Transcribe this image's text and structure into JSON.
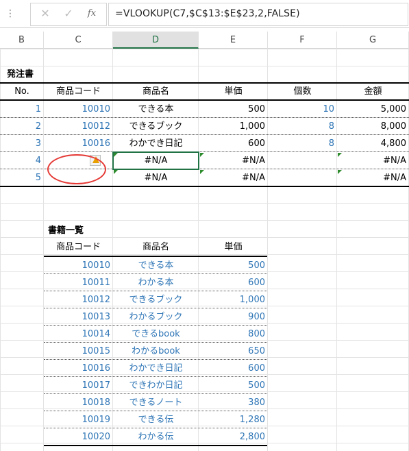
{
  "formula_bar": {
    "cancel_icon": "✕",
    "enter_icon": "✓",
    "fx_label": "fx",
    "formula": "=VLOOKUP(C7,$C$13:$E$23,2,FALSE)"
  },
  "columns": [
    "B",
    "C",
    "D",
    "E",
    "F",
    "G"
  ],
  "order": {
    "title": "発注書",
    "headers": {
      "no": "No.",
      "code": "商品コード",
      "name": "商品名",
      "price": "単価",
      "qty": "個数",
      "amount": "金額"
    },
    "rows": [
      {
        "no": "1",
        "code": "10010",
        "name": "できる本",
        "price": "500",
        "qty": "10",
        "amount": "5,000"
      },
      {
        "no": "2",
        "code": "10012",
        "name": "できるブック",
        "price": "1,000",
        "qty": "8",
        "amount": "8,000"
      },
      {
        "no": "3",
        "code": "10016",
        "name": "わかでき日記",
        "price": "600",
        "qty": "8",
        "amount": "4,800"
      },
      {
        "no": "4",
        "code": "",
        "name": "#N/A",
        "price": "#N/A",
        "qty": "",
        "amount": "#N/A"
      },
      {
        "no": "5",
        "code": "",
        "name": "#N/A",
        "price": "#N/A",
        "qty": "",
        "amount": "#N/A"
      }
    ]
  },
  "books": {
    "title": "書籍一覧",
    "headers": {
      "code": "商品コード",
      "name": "商品名",
      "price": "単価"
    },
    "rows": [
      {
        "code": "10010",
        "name": "できる本",
        "price": "500"
      },
      {
        "code": "10011",
        "name": "わかる本",
        "price": "600"
      },
      {
        "code": "10012",
        "name": "できるブック",
        "price": "1,000"
      },
      {
        "code": "10013",
        "name": "わかるブック",
        "price": "900"
      },
      {
        "code": "10014",
        "name": "できるbook",
        "price": "800"
      },
      {
        "code": "10015",
        "name": "わかるbook",
        "price": "650"
      },
      {
        "code": "10016",
        "name": "わかでき日記",
        "price": "600"
      },
      {
        "code": "10017",
        "name": "できわか日記",
        "price": "500"
      },
      {
        "code": "10018",
        "name": "できるノート",
        "price": "380"
      },
      {
        "code": "10019",
        "name": "できる伝",
        "price": "1,280"
      },
      {
        "code": "10020",
        "name": "わかる伝",
        "price": "2,800"
      }
    ]
  },
  "colors": {
    "accent": "#217346",
    "value_blue": "#2e75b6",
    "annotation_red": "#e53935",
    "error_tag": "#2e8b2e"
  }
}
